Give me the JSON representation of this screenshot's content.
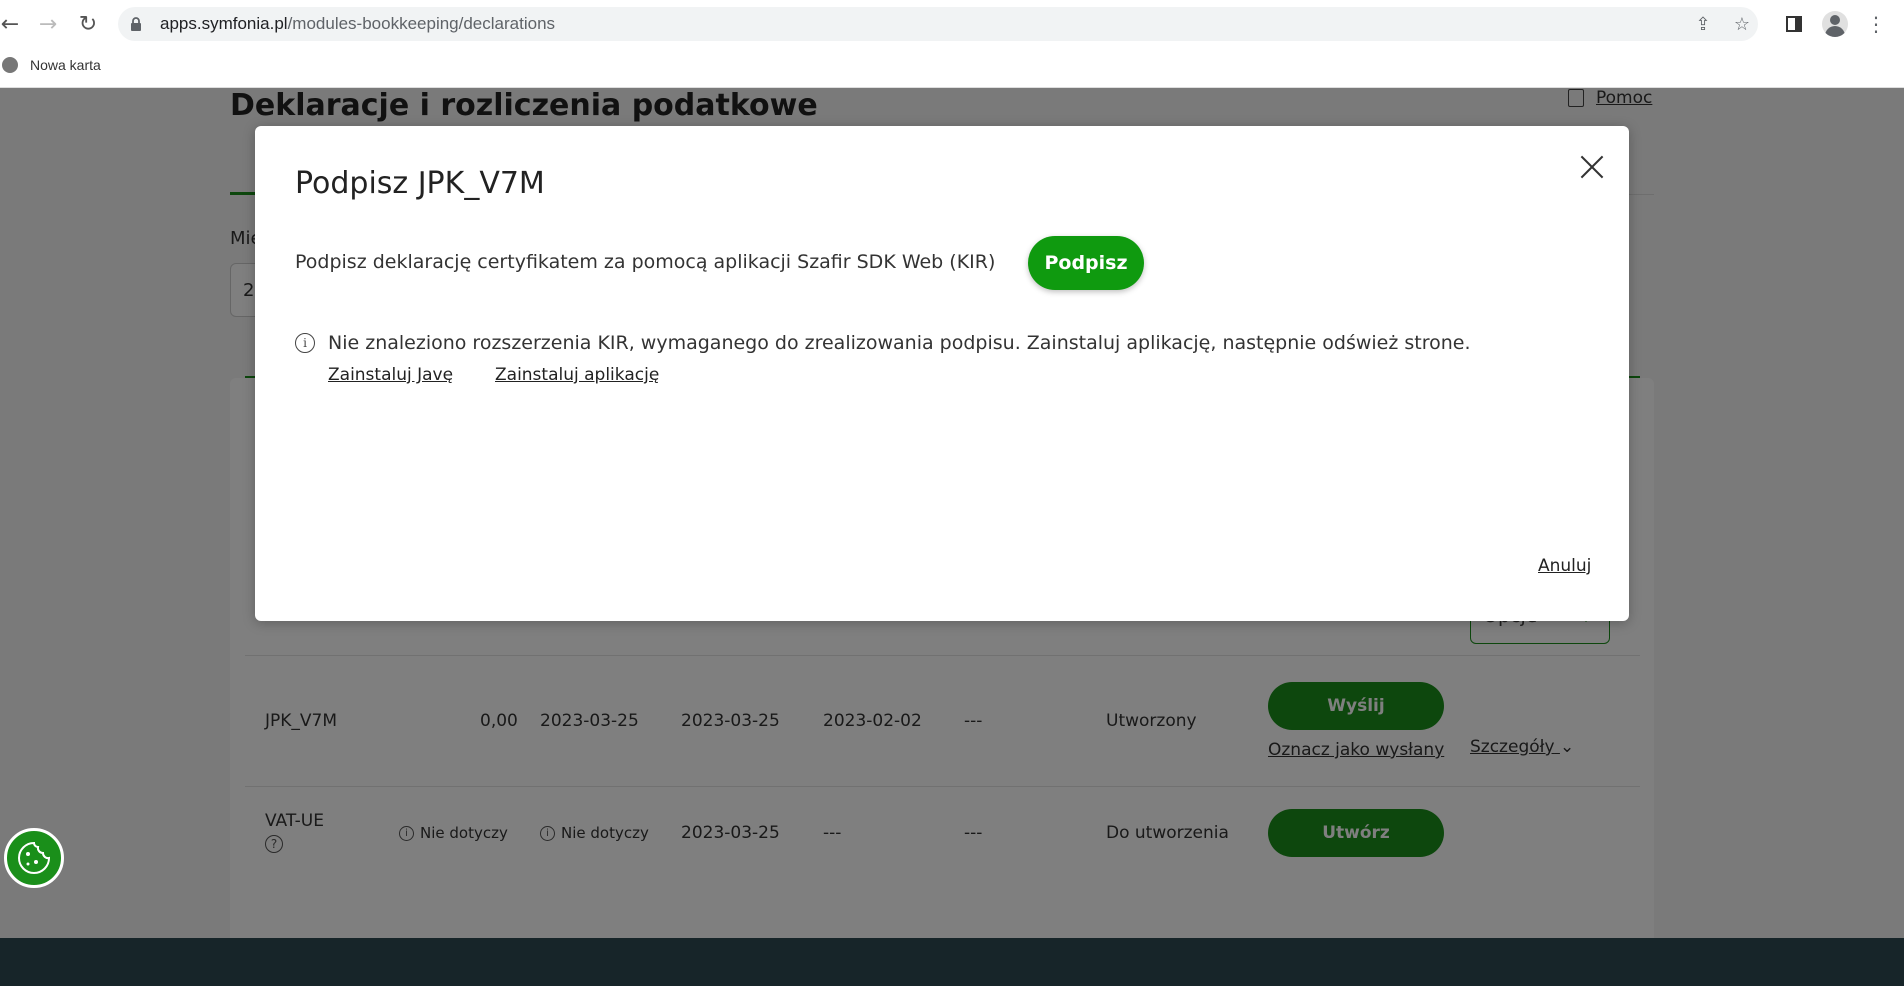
{
  "browser": {
    "url_host": "apps.symfonia.pl",
    "url_path": "/modules-bookkeeping/declarations",
    "bookmark": "Nowa karta"
  },
  "page": {
    "title": "Deklaracje i rozliczenia podatkowe",
    "help": "Pomoc",
    "filter_label": "Mie",
    "filter_value": "2",
    "rows": [
      {
        "name": "JPK_V7M",
        "amount": "0,00",
        "date1": "2023-03-25",
        "date2": "2023-03-25",
        "date3": "2023-02-02",
        "dash": "---",
        "status": "Utworzony",
        "action": "Wyślij",
        "mark_sent": "Oznacz jako wysłany",
        "options": "Opcje",
        "details": "Szczegóły"
      },
      {
        "name": "VAT-UE",
        "note1": "Nie dotyczy",
        "note2": "Nie dotyczy",
        "date2": "2023-03-25",
        "dash1": "---",
        "dash2": "---",
        "status": "Do utworzenia",
        "action": "Utwórz"
      }
    ]
  },
  "modal": {
    "title": "Podpisz JPK_V7M",
    "description": "Podpisz deklarację certyfikatem za pomocą aplikacji Szafir SDK Web (KIR)",
    "sign_button": "Podpisz",
    "info": "Nie znaleziono rozszerzenia KIR, wymaganego do zrealizowania podpisu. Zainstaluj aplikację, następnie odśwież strone.",
    "link_java": "Zainstaluj Javę",
    "link_app": "Zainstaluj aplikację",
    "cancel": "Anuluj"
  },
  "colors": {
    "accent": "#1a8f1a",
    "footer": "#2e4a52"
  }
}
